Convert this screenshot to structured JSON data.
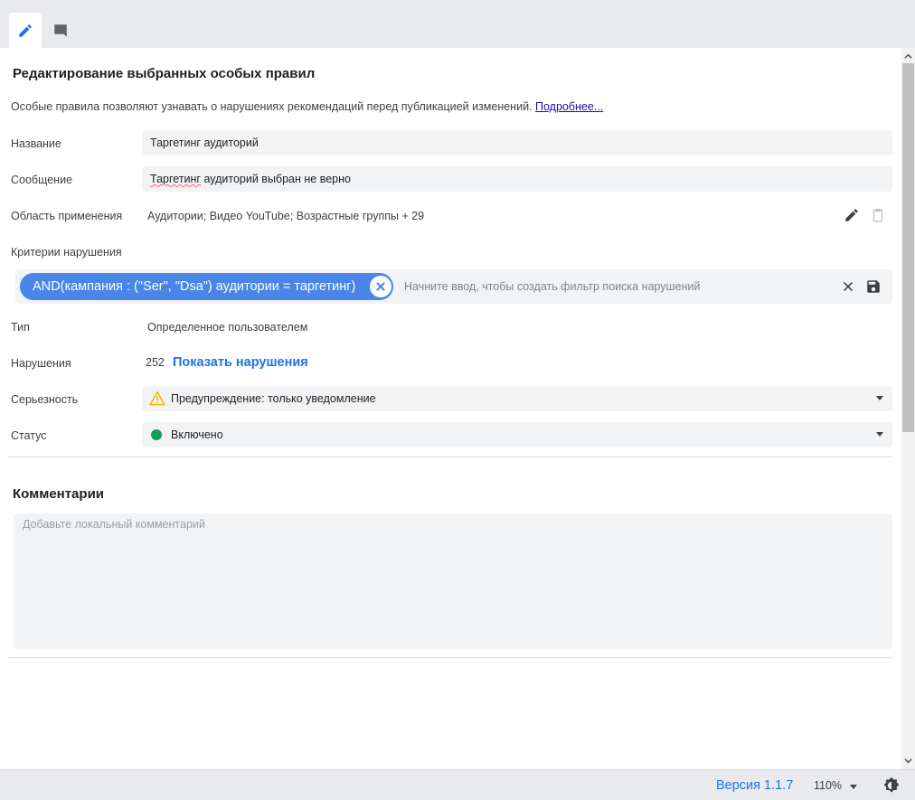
{
  "tabs": [
    {
      "icon": "pencil-icon",
      "active": true
    },
    {
      "icon": "comment-icon",
      "active": false
    }
  ],
  "header": {
    "title": "Редактирование выбранных особых правил",
    "intro_text": "Особые правила позволяют узнавать о нарушениях рекомендаций перед публикацией изменений.",
    "intro_link": "Подробнее..."
  },
  "form": {
    "name_label": "Название",
    "name_value": "Таргетинг аудиторий",
    "message_label": "Сообщение",
    "message_value_misspelled": "Таргетинг",
    "message_value_rest": " аудиторий выбран не верно",
    "scope_label": "Область применения",
    "scope_value": "Аудитории; Видео YouTube; Возрастные группы + 29",
    "criteria_label": "Критерии нарушения",
    "criteria_chip": "AND(кампания : (\"Ser\", \"Dsa\") аудитории = таргетинг)",
    "criteria_placeholder": "Начните ввод, чтобы создать фильтр поиска нарушений",
    "type_label": "Тип",
    "type_value": "Определенное пользователем",
    "violations_label": "Нарушения",
    "violations_count": "252",
    "violations_link": "Показать нарушения",
    "severity_label": "Серьезность",
    "severity_value": "Предупреждение: только уведомление",
    "status_label": "Статус",
    "status_value": "Включено"
  },
  "comments": {
    "title": "Комментарии",
    "placeholder": "Добавьте локальный комментарий"
  },
  "statusbar": {
    "version": "Версия 1.1.7",
    "zoom": "110%"
  },
  "colors": {
    "accent": "#1a73e8",
    "chip": "#4a86e8",
    "warning": "#f4b400",
    "status_on": "#0f9d58"
  }
}
